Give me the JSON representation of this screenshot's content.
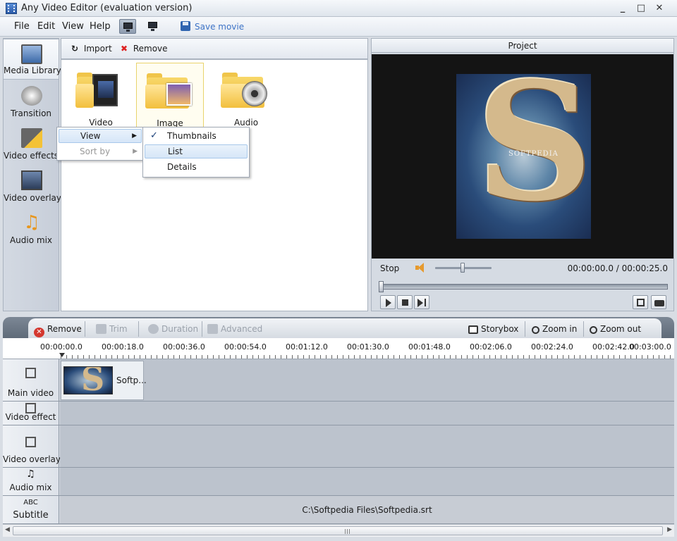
{
  "window": {
    "title": "Any Video Editor (evaluation version)",
    "controls": [
      "_",
      "□",
      "✕"
    ]
  },
  "menubar": {
    "items": [
      "File",
      "Edit",
      "View",
      "Help"
    ],
    "save_movie": "Save movie"
  },
  "sidebar": {
    "items": [
      {
        "label": "Media Library",
        "icon": "media-library-icon"
      },
      {
        "label": "Transition",
        "icon": "transition-icon"
      },
      {
        "label": "Video effects",
        "icon": "video-effects-icon"
      },
      {
        "label": "Video overlay",
        "icon": "video-overlay-icon"
      },
      {
        "label": "Audio mix",
        "icon": "music-note-icon"
      }
    ]
  },
  "library": {
    "import_label": "Import",
    "remove_label": "Remove",
    "folders": [
      {
        "label": "Video",
        "icon": "video-folder-icon"
      },
      {
        "label": "Image",
        "icon": "image-folder-icon"
      },
      {
        "label": "Audio",
        "icon": "audio-folder-icon"
      }
    ]
  },
  "context_menu": {
    "items": [
      {
        "label": "View",
        "arrow": "▶"
      },
      {
        "label": "Sort by",
        "arrow": "▶"
      }
    ],
    "submenu": [
      {
        "label": "Thumbnails",
        "check": "✓"
      },
      {
        "label": "List"
      },
      {
        "label": "Details"
      }
    ]
  },
  "project": {
    "title": "Project",
    "state": "Stop",
    "time": "00:00:00.0 / 00:00:25.0",
    "watermark": "SOFTPEDIA",
    "preview_letter": "S"
  },
  "timeline_toolbar": {
    "remove": "Remove",
    "trim": "Trim",
    "duration": "Duration",
    "advanced": "Advanced",
    "storybox": "Storybox",
    "zoom_in": "Zoom in",
    "zoom_out": "Zoom out"
  },
  "ruler": {
    "ticks": [
      "00:00:00.0",
      "00:00:18.0",
      "00:00:36.0",
      "00:00:54.0",
      "00:01:12.0",
      "00:01:30.0",
      "00:01:48.0",
      "00:02:06.0",
      "00:02:24.0",
      "00:02:42.0",
      "00:03:00.0"
    ]
  },
  "tracks": {
    "main_video": {
      "label": "Main video",
      "clip_label": "Softp..."
    },
    "video_effect": {
      "label": "Video effect"
    },
    "video_overlay": {
      "label": "Video overlay"
    },
    "audio_mix": {
      "label": "Audio mix"
    },
    "subtitle": {
      "label": "Subtitle",
      "small": "ABC",
      "file": "C:\\Softpedia Files\\Softpedia.srt"
    }
  }
}
